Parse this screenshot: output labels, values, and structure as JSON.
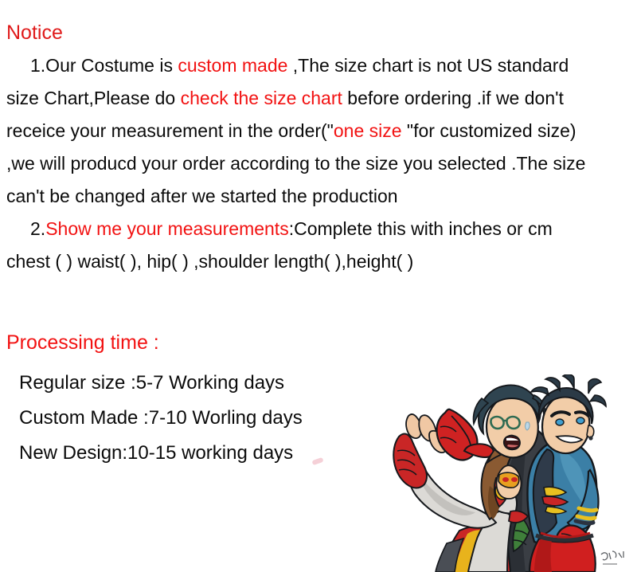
{
  "notice": {
    "heading": "Notice",
    "lines": [
      {
        "id": "line1",
        "indent": true,
        "parts": [
          {
            "text": "1.Our Costume is ",
            "color": "black"
          },
          {
            "text": "custom made",
            "color": "red"
          },
          {
            "text": " ,The size chart is not US standard",
            "color": "black"
          }
        ]
      },
      {
        "id": "line2",
        "indent": false,
        "parts": [
          {
            "text": "size Chart,Please do ",
            "color": "black"
          },
          {
            "text": "check the size chart",
            "color": "red"
          },
          {
            "text": " before ordering .if we don't",
            "color": "black"
          }
        ]
      },
      {
        "id": "line3",
        "indent": false,
        "parts": [
          {
            "text": "receice your measurement in the order(\"",
            "color": "black"
          },
          {
            "text": "one size",
            "color": "red"
          },
          {
            "text": " \"for customized size)",
            "color": "black"
          }
        ]
      },
      {
        "id": "line4",
        "indent": false,
        "parts": [
          {
            "text": ",we will producd your order according to the size you selected .The size",
            "color": "black"
          }
        ]
      },
      {
        "id": "line5",
        "indent": false,
        "parts": [
          {
            "text": "can't be changed after we started the production",
            "color": "black"
          }
        ]
      },
      {
        "id": "line6",
        "indent": true,
        "parts": [
          {
            "text": "2.",
            "color": "black"
          },
          {
            "text": "Show me your measurements",
            "color": "red"
          },
          {
            "text": ":Complete this with inches or cm",
            "color": "black"
          }
        ]
      },
      {
        "id": "line7",
        "indent": false,
        "parts": [
          {
            "text": " chest (      ) waist(     ),  hip(     ) ,shoulder length(        ),height(    )",
            "color": "black"
          }
        ]
      }
    ]
  },
  "processing": {
    "heading": "Processing time :",
    "lines": [
      "Regular size :5-7 Working days",
      "Custom Made :7-10 Worling days",
      "New Design:10-15 working days"
    ]
  },
  "illustration": {
    "name": "superhero-couple-illustration",
    "description": "Comic style drawing of two superhero characters posing together making a heart shape with hands",
    "characters": [
      {
        "name": "masked-heroine",
        "hair_color": "#7a4a2a",
        "mask_color": "#e8a020",
        "suit_color": "#c92626",
        "sleeve_color": "#d8d6d2"
      },
      {
        "name": "superboy",
        "hair_color": "#2b3a46",
        "jacket_color": "#3b7fa6",
        "shirt_color": "#2f3b4a",
        "pants_color": "#d01f1f",
        "cape_color": "#35393f",
        "emblem_colors": [
          "#e8c020",
          "#c92626"
        ]
      }
    ],
    "signature": "artist-signature"
  },
  "colors": {
    "background": "#ffffff",
    "text": "#0b0b0b",
    "accent_red": "#f21212",
    "heading_red": "#e01b1b"
  }
}
